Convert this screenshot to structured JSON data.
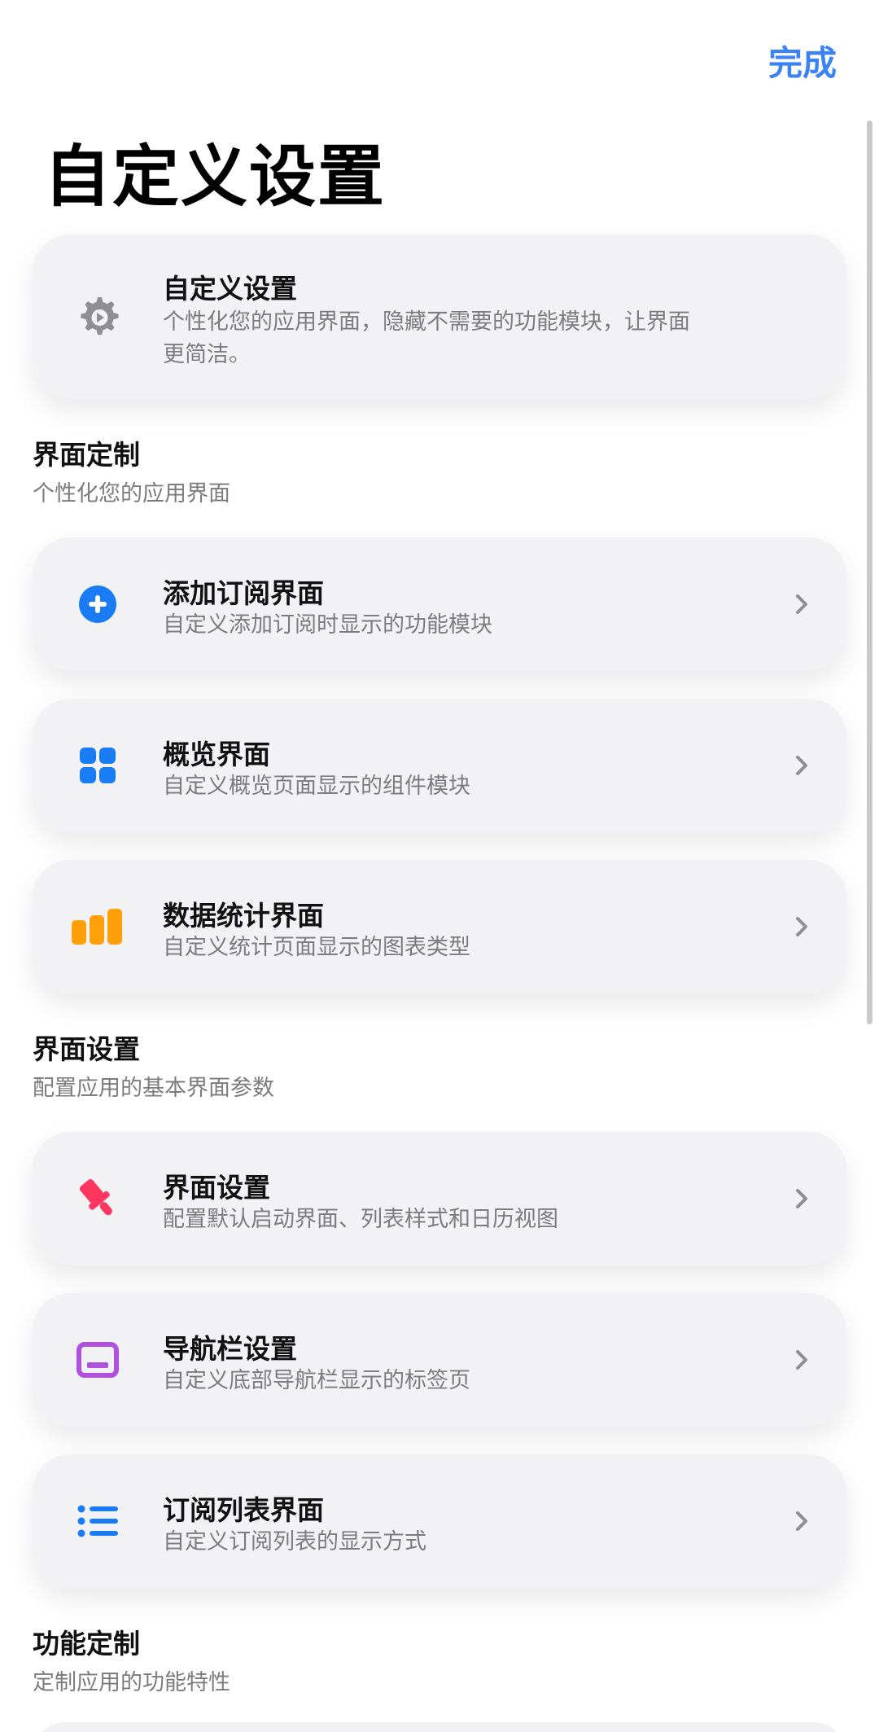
{
  "header": {
    "done_label": "完成",
    "page_title": "自定义设置"
  },
  "intro_card": {
    "title": "自定义设置",
    "subtitle_line1": "个性化您的应用界面，隐藏不需要的功能模块，让界面",
    "subtitle_line2": "更简洁。",
    "icon": "gear-icon"
  },
  "sections": [
    {
      "title": "界面定制",
      "subtitle": "个性化您的应用界面",
      "items": [
        {
          "title": "添加订阅界面",
          "subtitle": "自定义添加订阅时显示的功能模块",
          "icon": "plus-circle-icon",
          "color": "#1a7cf5"
        },
        {
          "title": "概览界面",
          "subtitle": "自定义概览页面显示的组件模块",
          "icon": "grid-icon",
          "color": "#1a7cf5"
        },
        {
          "title": "数据统计界面",
          "subtitle": "自定义统计页面显示的图表类型",
          "icon": "bar-chart-icon",
          "color": "#ff9f0a"
        }
      ]
    },
    {
      "title": "界面设置",
      "subtitle": "配置应用的基本界面参数",
      "items": [
        {
          "title": "界面设置",
          "subtitle": "配置默认启动界面、列表样式和日历视图",
          "icon": "paintbrush-icon",
          "color": "#ff375f"
        },
        {
          "title": "导航栏设置",
          "subtitle": "自定义底部导航栏显示的标签页",
          "icon": "dock-icon",
          "color": "#af52de"
        },
        {
          "title": "订阅列表界面",
          "subtitle": "自定义订阅列表的显示方式",
          "icon": "list-icon",
          "color": "#1a7cf5"
        }
      ]
    },
    {
      "title": "功能定制",
      "subtitle": "定制应用的功能特性"
    }
  ]
}
